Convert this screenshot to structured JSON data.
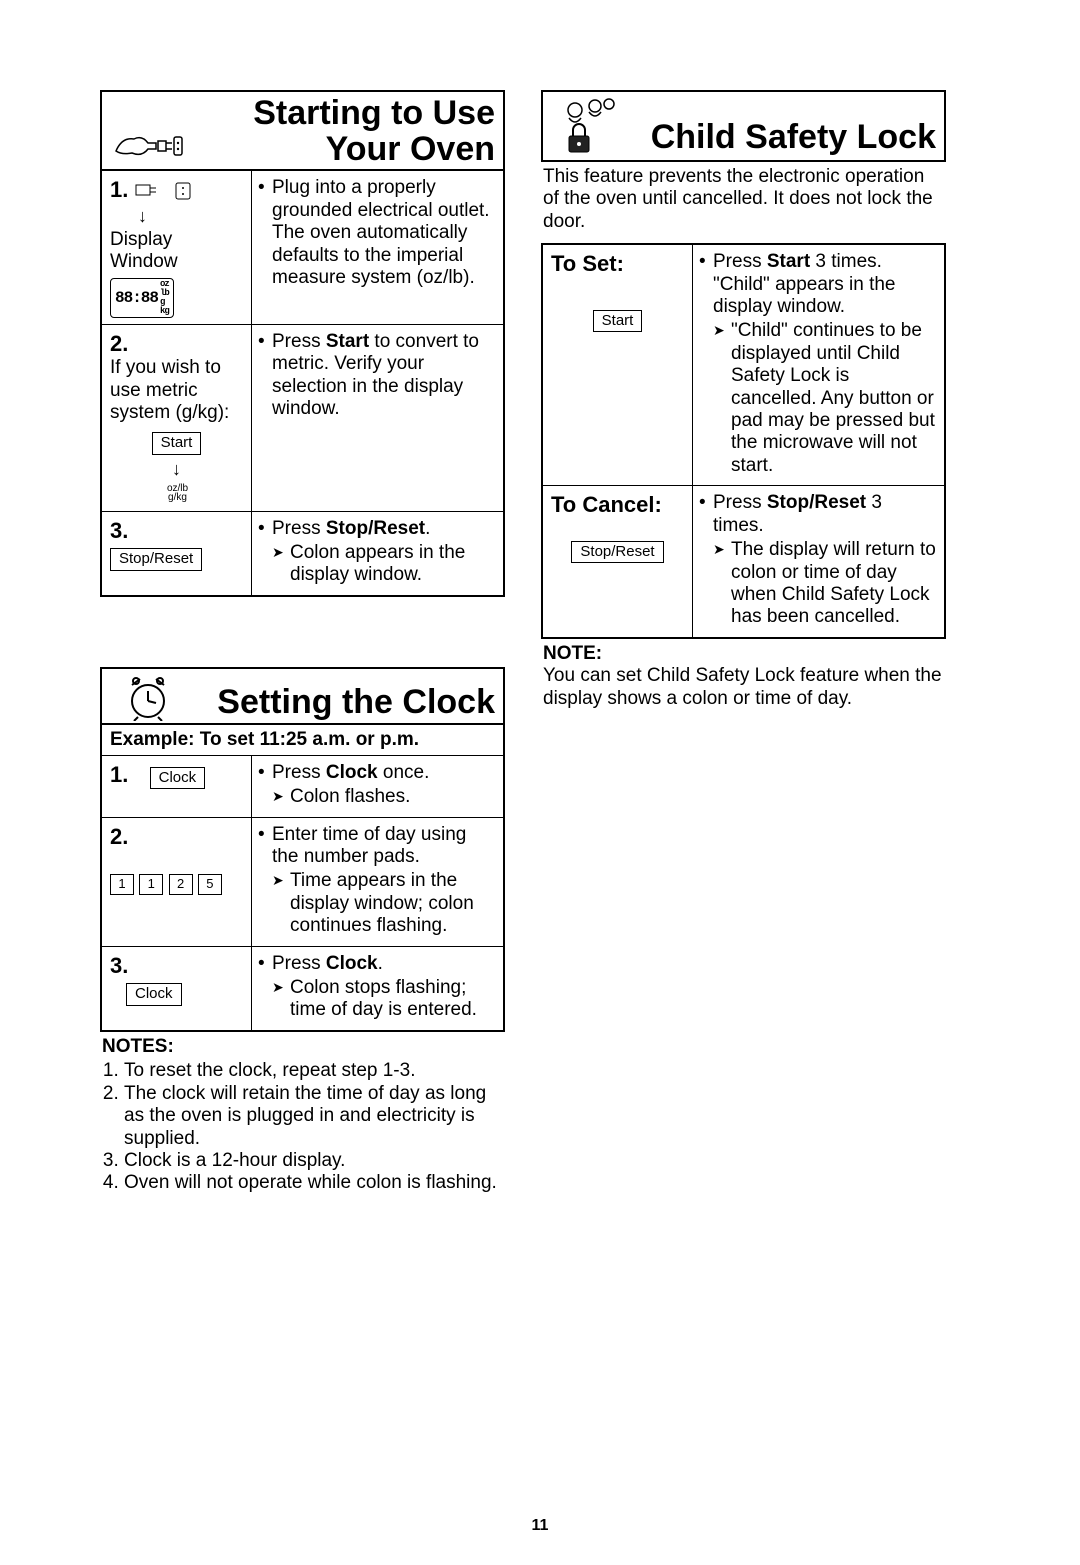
{
  "page_number": "11",
  "starting": {
    "title": "Starting to Use\nYour Oven",
    "rows": [
      {
        "num": "1.",
        "left_label": "Display Window",
        "display_text": "88:88",
        "instr": [
          {
            "type": "bullet",
            "text": "Plug into a properly grounded electrical outlet.\nThe oven automatically defaults to the imperial measure system (oz/lb)."
          }
        ]
      },
      {
        "num": "2.",
        "left_text": "If you wish to use metric system (g/kg):",
        "btn": "Start",
        "instr": [
          {
            "type": "bullet",
            "pre": "Press ",
            "bold": "Start",
            "post": " to convert to metric. Verify your selection in the display window."
          }
        ]
      },
      {
        "num": "3.",
        "btn": "Stop/Reset",
        "instr": [
          {
            "type": "bullet",
            "pre": "Press ",
            "bold": "Stop/Reset",
            "post": "."
          },
          {
            "type": "arrow",
            "text": "Colon appears in the display window."
          }
        ]
      }
    ]
  },
  "clock": {
    "title": "Setting the Clock",
    "example": "Example: To set 11:25 a.m. or p.m.",
    "rows": [
      {
        "num": "1.",
        "btn": "Clock",
        "instr": [
          {
            "type": "bullet",
            "pre": "Press ",
            "bold": "Clock",
            "post": " once."
          },
          {
            "type": "arrow",
            "text": "Colon flashes."
          }
        ]
      },
      {
        "num": "2.",
        "pads": [
          "1",
          "1",
          "2",
          "5"
        ],
        "instr": [
          {
            "type": "bullet",
            "text": "Enter time of day using the number pads."
          },
          {
            "type": "arrow",
            "text": "Time appears in the display window; colon continues flashing."
          }
        ]
      },
      {
        "num": "3.",
        "btn": "Clock",
        "instr": [
          {
            "type": "bullet",
            "pre": "Press ",
            "bold": "Clock",
            "post": "."
          },
          {
            "type": "arrow",
            "text": "Colon stops flashing; time of day is entered."
          }
        ]
      }
    ],
    "notes_title": "NOTES:",
    "notes": [
      "To reset the clock, repeat step 1-3.",
      "The clock will retain the time of day as long as the oven is plugged in and electricity is supplied.",
      "Clock is a 12-hour display.",
      "Oven will not operate while colon is flashing."
    ]
  },
  "lock": {
    "title": "Child Safety Lock",
    "intro": "This feature prevents the electronic operation of the oven until cancelled. It does not lock the door.",
    "rows": [
      {
        "label": "To Set:",
        "btn": "Start",
        "instr": [
          {
            "type": "bullet",
            "pre": "Press ",
            "bold": "Start",
            "post": " 3 times. \"Child\" appears in the display window."
          },
          {
            "type": "arrow",
            "text": "\"Child\" continues to be displayed until Child Safety Lock is cancelled. Any button or pad may be pressed but the microwave will not start."
          }
        ]
      },
      {
        "label": "To Cancel:",
        "btn": "Stop/Reset",
        "instr": [
          {
            "type": "bullet",
            "pre": "Press ",
            "bold": "Stop/Reset",
            "post": " 3 times."
          },
          {
            "type": "arrow",
            "text": "The display will return to colon or time of day when Child Safety Lock has been cancelled."
          }
        ]
      }
    ],
    "note_title": "NOTE:",
    "note_text": "You can set Child Safety Lock feature when the display shows a colon or time of day."
  }
}
